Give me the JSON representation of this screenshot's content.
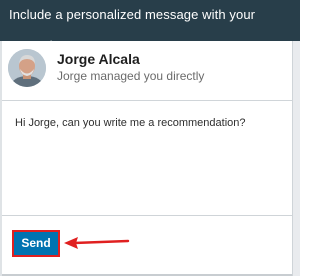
{
  "modal": {
    "header_text": "Include a personalized message with your request"
  },
  "recipient": {
    "name": "Jorge Alcala",
    "relation": "Jorge managed you directly"
  },
  "message": {
    "text": "Hi Jorge, can you write me a recommendation?"
  },
  "actions": {
    "send_label": "Send"
  },
  "colors": {
    "header_bg": "#283e4a",
    "button_bg": "#0073b1",
    "highlight": "#e02020"
  }
}
